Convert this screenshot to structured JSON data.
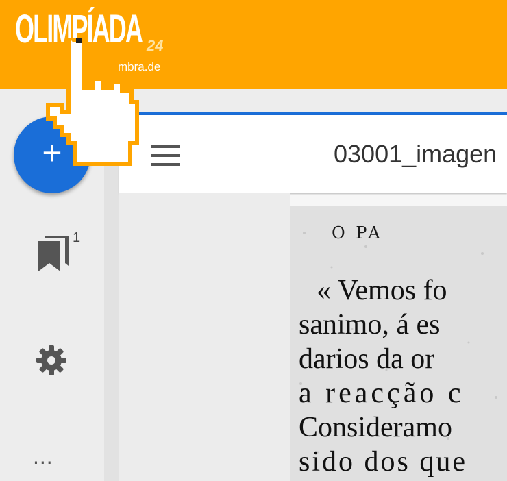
{
  "header": {
    "logo_text": "OLIMPÍADA",
    "logo_badge": "24",
    "logo_sub": "mbra.de",
    "color": "#ffa500"
  },
  "sidebar": {
    "fab": {
      "label": "+",
      "color": "#1a6ed8"
    },
    "bookmarks": {
      "icon": "bookmarks-icon",
      "count": "1"
    },
    "settings": {
      "icon": "gear-icon"
    },
    "more": {
      "label": "..."
    }
  },
  "toolbar": {
    "menu_icon": "menu-icon",
    "title": "03001_imagen"
  },
  "document": {
    "heading": "O PA",
    "lines": [
      "« Vemos fo",
      "sanimo, á es",
      "darios da or",
      "a reacção c",
      "Consideramo",
      "sido dos que"
    ]
  },
  "overlay": {
    "cursor_icon": "pointing-hand-cursor-icon"
  }
}
